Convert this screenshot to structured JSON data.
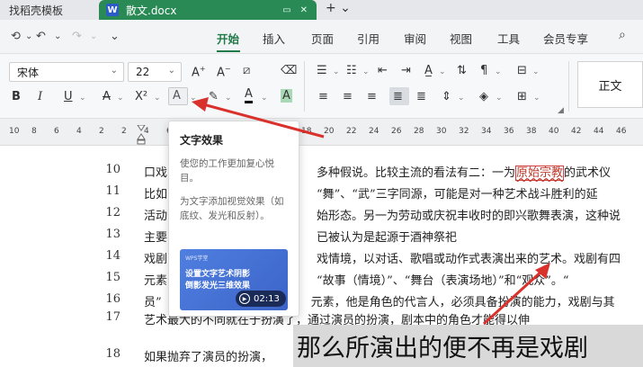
{
  "tabs": {
    "inactive_title": "找稻壳模板",
    "active_title": "散文.docx",
    "doc_icon_letter": "W"
  },
  "menu": {
    "items": [
      "开始",
      "插入",
      "页面",
      "引用",
      "审阅",
      "视图",
      "工具",
      "会员专享"
    ],
    "active": "开始"
  },
  "ribbon": {
    "font_name": "宋体",
    "font_size": "22",
    "style_label": "正文",
    "grow_font": "A⁺",
    "shrink_font": "A⁻",
    "bold": "B",
    "italic": "I",
    "underline": "U",
    "strike": "A",
    "superscript": "X²",
    "text_effect": "A",
    "highlight": "ab",
    "font_color": "A",
    "char_shading": "A"
  },
  "ruler": {
    "numbers": [
      "10",
      "8",
      "6",
      "4",
      "2",
      "2",
      "4",
      "6",
      "8",
      "10",
      "12",
      "14",
      "16",
      "18",
      "20",
      "22",
      "24",
      "26",
      "28",
      "30",
      "32",
      "34",
      "36",
      "38",
      "40",
      "42",
      "44",
      "46"
    ]
  },
  "tooltip": {
    "title": "文字效果",
    "desc": "使您的工作更加复心悦目。",
    "desc2": "为文字添加视觉效果（如底纹、发光和反射）。",
    "card_logo": "WPS学堂",
    "card_text": "设置文字艺术阴影\n倒影发光三维效果",
    "duration": "02:13"
  },
  "document": {
    "lines": [
      {
        "num": "10",
        "pre": "口戏",
        "post": "多种假说。比较主流的看法有二：一为",
        "red": "原始宗教",
        "tail": "的武术仪"
      },
      {
        "num": "11",
        "pre": "比如",
        "post": "“舞”、“武”三字同源，可能是对一种艺术战斗胜利的延"
      },
      {
        "num": "12",
        "pre": "活动",
        "post": "始形态。另一为劳动或庆祝丰收时的即兴歌舞表演，这种说"
      },
      {
        "num": "13",
        "pre": "主要",
        "post": "已被认为是起源于酒神祭祀"
      },
      {
        "num": "14",
        "pre": "戏剧",
        "post": "戏情境，以对话、歌唱或动作式表演出来的艺术。戏剧有四"
      },
      {
        "num": "15",
        "pre": "元素",
        "post": "“故事（情境）”、“舞台（表演场地）”和“观众”。“"
      },
      {
        "num": "16",
        "pre": "员”",
        "post": "元素，他是角色的代言人，必须具备扮演的能力，戏剧与其"
      },
      {
        "num": "17",
        "pre": "艺术",
        "post": "最大的不同就在于扮演了，通过演员的扮演，剧本中的角色才能得以伸"
      },
      {
        "num": "18",
        "pre": "",
        "post": "如果抛弃了演员的扮演，"
      }
    ],
    "selected_text": "那么所演出的便不再是戏剧"
  }
}
